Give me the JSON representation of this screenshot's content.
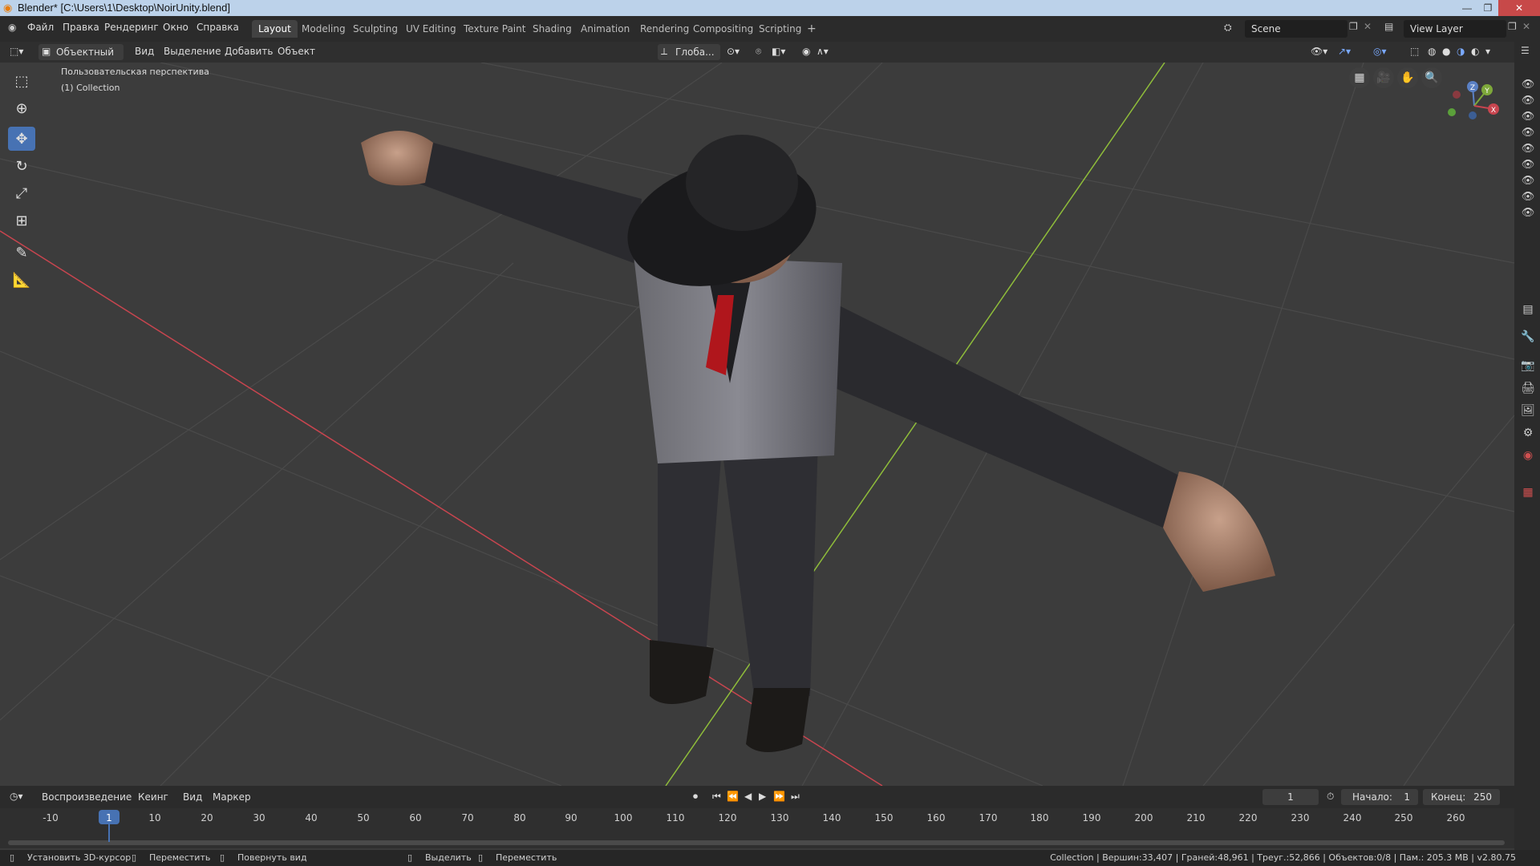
{
  "window": {
    "title": "Blender* [C:\\Users\\1\\Desktop\\NoirUnity.blend]"
  },
  "menu": {
    "items": [
      "Файл",
      "Правка",
      "Рендеринг",
      "Окно",
      "Справка"
    ]
  },
  "workspaces": {
    "tabs": [
      "Layout",
      "Modeling",
      "Sculpting",
      "UV Editing",
      "Texture Paint",
      "Shading",
      "Animation",
      "Rendering",
      "Compositing",
      "Scripting"
    ],
    "active": "Layout"
  },
  "scene": {
    "name": "Scene",
    "view_layer": "View Layer"
  },
  "header": {
    "mode": "Объектный ...",
    "items": [
      "Вид",
      "Выделение",
      "Добавить",
      "Объект"
    ],
    "orientation": "Глоба..."
  },
  "viewport": {
    "perspective": "Пользовательская перспектива",
    "collection": "(1) Collection",
    "gizmo_axes": [
      "Z",
      "Y",
      "X"
    ]
  },
  "timeline": {
    "menus": [
      "Воспроизведение",
      "Кеинг",
      "Вид",
      "Маркер"
    ],
    "current_frame": "1",
    "start_label": "Начало:",
    "start": "1",
    "end_label": "Конец:",
    "end": "250",
    "ticks": [
      "-10",
      "1",
      "10",
      "20",
      "30",
      "40",
      "50",
      "60",
      "70",
      "80",
      "90",
      "100",
      "110",
      "120",
      "130",
      "140",
      "150",
      "160",
      "170",
      "180",
      "190",
      "200",
      "210",
      "220",
      "230",
      "240",
      "250",
      "260"
    ]
  },
  "status": {
    "hints": [
      "Установить 3D-курсор",
      "Переместить",
      "Повернуть вид",
      "Выделить",
      "Переместить"
    ],
    "stats": "Collection | Вершин:33,407 | Граней:48,961 | Треуг.:52,866 | Объектов:0/8 | Пам.: 205.3 MB | v2.80.75"
  },
  "colors": {
    "accent": "#4772b3",
    "x_axis": "#c8454f",
    "y_axis": "#8fbd3a"
  }
}
